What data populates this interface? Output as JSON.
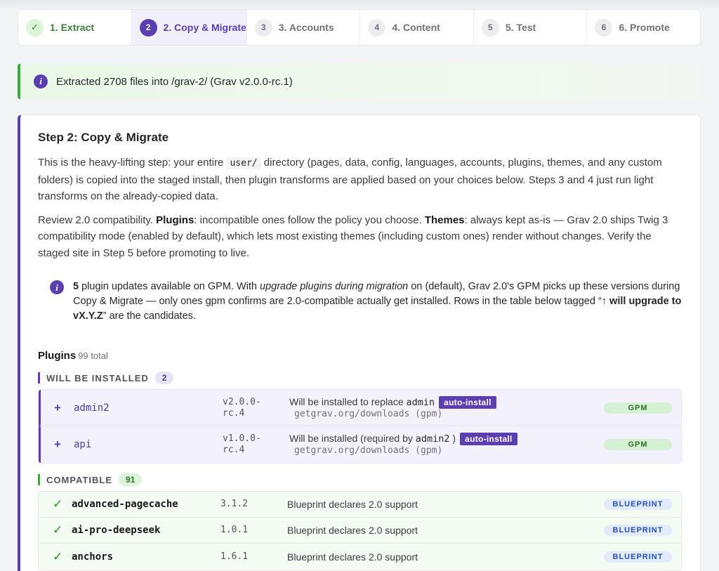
{
  "stepper": [
    {
      "num": "✓",
      "label": "1. Extract",
      "state": "done"
    },
    {
      "num": "2",
      "label": "2. Copy & Migrate",
      "state": "active"
    },
    {
      "num": "3",
      "label": "3. Accounts",
      "state": "pending"
    },
    {
      "num": "4",
      "label": "4. Content",
      "state": "pending"
    },
    {
      "num": "5",
      "label": "5. Test",
      "state": "pending"
    },
    {
      "num": "6",
      "label": "6. Promote",
      "state": "pending"
    }
  ],
  "notice": {
    "icon": "info-icon",
    "text": "Extracted 2708 files into /grav-2/ (Grav v2.0.0-rc.1)"
  },
  "card": {
    "title": "Step 2: Copy & Migrate",
    "p1": {
      "a": "This is the heavy-lifting step: your entire ",
      "code": "user/",
      "b": " directory (pages, data, config, languages, accounts, plugins, themes, and any custom folders) is copied into the staged install, then plugin transforms are applied based on your choices below. Steps 3 and 4 just run light transforms on the already-copied data."
    },
    "p2": {
      "a": "Review 2.0 compatibility. ",
      "plugins_bold": "Plugins",
      "b": ": incompatible ones follow the policy you choose. ",
      "themes_bold": "Themes",
      "c": ": always kept as-is — Grav 2.0 ships Twig 3 compatibility mode (enabled by default), which lets most existing themes (including custom ones) render without changes. Verify the staged site in Step 5 before promoting to live."
    },
    "callout": {
      "count": "5",
      "a": " plugin updates available on GPM. With ",
      "em": "upgrade plugins during migration",
      "b": " on (default), Grav 2.0's GPM picks up these versions during Copy & Migrate — only ones gpm confirms are 2.0-compatible actually get installed. Rows in the table below tagged “",
      "tag": "↑ will upgrade to vX.Y.Z",
      "c": "” are the candidates."
    }
  },
  "plugins": {
    "heading": "Plugins",
    "total": "99 total",
    "install_group": {
      "label": "WILL BE INSTALLED",
      "count": "2"
    },
    "install_rows": [
      {
        "mark": "+",
        "name": "admin2",
        "version": "v2.0.0-rc.4",
        "desc_a": "Will be installed to replace ",
        "desc_code": "admin",
        "desc_b": "",
        "tag": "auto-install",
        "source": "getgrav.org/downloads (gpm)",
        "badge": "GPM"
      },
      {
        "mark": "+",
        "name": "api",
        "version": "v1.0.0-rc.4",
        "desc_a": "Will be installed (required by ",
        "desc_code": "admin2",
        "desc_b": ")",
        "tag": "auto-install",
        "source": "getgrav.org/downloads (gpm)",
        "badge": "GPM"
      }
    ],
    "compat_group": {
      "label": "COMPATIBLE",
      "count": "91"
    },
    "compat_rows": [
      {
        "mark": "✓",
        "name": "advanced-pagecache",
        "version": "3.1.2",
        "desc": "Blueprint declares 2.0 support",
        "badge": "BLUEPRINT"
      },
      {
        "mark": "✓",
        "name": "ai-pro-deepseek",
        "version": "1.0.1",
        "desc": "Blueprint declares 2.0 support",
        "badge": "BLUEPRINT"
      },
      {
        "mark": "✓",
        "name": "anchors",
        "version": "1.6.1",
        "desc": "Blueprint declares 2.0 support",
        "badge": "BLUEPRINT"
      }
    ]
  },
  "colors": {
    "accent": "#5b3fb0",
    "success": "#3bab3b",
    "blueprint": "#2350b8"
  }
}
